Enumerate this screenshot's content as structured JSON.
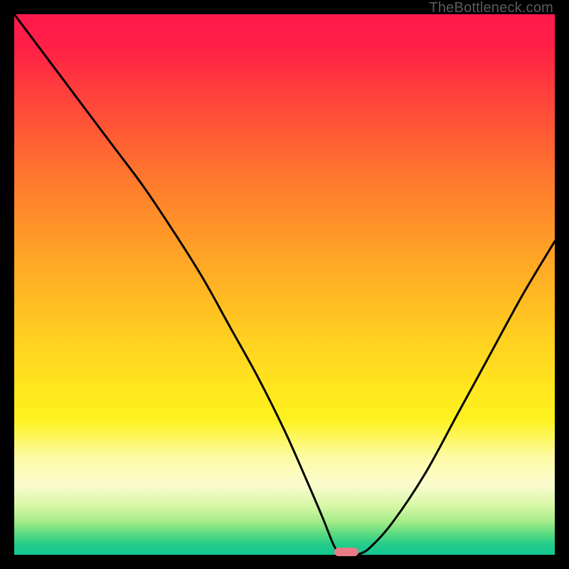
{
  "watermark": "TheBottleneck.com",
  "colors": {
    "frame": "#000000",
    "curve": "#000000",
    "marker": "#e87b84",
    "gradient_top": "#ff1a4d",
    "gradient_bottom": "#12c792"
  },
  "chart_data": {
    "type": "line",
    "title": "",
    "xlabel": "",
    "ylabel": "",
    "xlim": [
      0,
      100
    ],
    "ylim": [
      0,
      100
    ],
    "series": [
      {
        "name": "bottleneck-curve",
        "x": [
          0,
          6,
          12,
          18,
          24,
          30,
          35,
          40,
          45,
          50,
          54,
          57,
          59,
          60,
          61,
          62,
          64,
          66,
          70,
          76,
          82,
          88,
          94,
          100
        ],
        "values": [
          100,
          92,
          84,
          76,
          68,
          59,
          51,
          42,
          33,
          23,
          14,
          7,
          2,
          0.5,
          0,
          0,
          0.2,
          1.5,
          6,
          15,
          26,
          37,
          48,
          58
        ]
      }
    ],
    "marker": {
      "x": 61.5,
      "y": 0.5
    },
    "notes": "Axis tick labels are not shown in the source image; x and y are normalized 0–100. Values are read from the plotted curve shape. The curve descends steeply from top-left to a minimum near x≈61 (y≈0) then rises toward the right edge reaching y≈58 at x=100."
  }
}
